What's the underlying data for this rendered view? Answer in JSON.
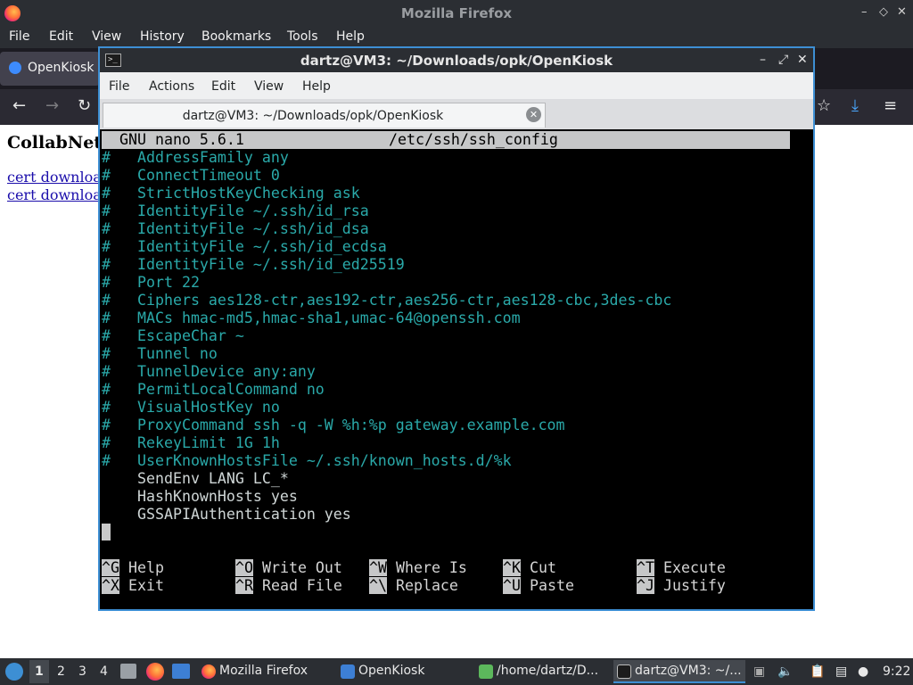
{
  "firefox": {
    "title": "Mozilla Firefox",
    "menu": [
      "File",
      "Edit",
      "View",
      "History",
      "Bookmarks",
      "Tools",
      "Help"
    ],
    "tab_label": "OpenKiosk -",
    "page": {
      "heading": "CollabNet",
      "links": [
        "cert downloa",
        "cert downloa"
      ]
    },
    "icons": {
      "back": "←",
      "forward": "→",
      "reload": "↻",
      "bookmark": "☆",
      "download": "⤓",
      "menu": "≡"
    },
    "window_controls": {
      "minimize": "–",
      "maximize": "◇",
      "close": "✕"
    }
  },
  "terminal": {
    "title": "dartz@VM3: ~/Downloads/opk/OpenKiosk",
    "menu": [
      "File",
      "Actions",
      "Edit",
      "View",
      "Help"
    ],
    "tab_label": "dartz@VM3: ~/Downloads/opk/OpenKiosk",
    "window_controls": {
      "minimize": "–",
      "maximize": "⤢",
      "close": "✕"
    },
    "nano": {
      "version": "GNU nano 5.6.1",
      "filename": "/etc/ssh/ssh_config",
      "lines": [
        {
          "hash": "#",
          "text": "AddressFamily any"
        },
        {
          "hash": "#",
          "text": "ConnectTimeout 0"
        },
        {
          "hash": "#",
          "text": "StrictHostKeyChecking ask"
        },
        {
          "hash": "#",
          "text": "IdentityFile ~/.ssh/id_rsa"
        },
        {
          "hash": "#",
          "text": "IdentityFile ~/.ssh/id_dsa"
        },
        {
          "hash": "#",
          "text": "IdentityFile ~/.ssh/id_ecdsa"
        },
        {
          "hash": "#",
          "text": "IdentityFile ~/.ssh/id_ed25519"
        },
        {
          "hash": "#",
          "text": "Port 22"
        },
        {
          "hash": "#",
          "text": "Ciphers aes128-ctr,aes192-ctr,aes256-ctr,aes128-cbc,3des-cbc"
        },
        {
          "hash": "#",
          "text": "MACs hmac-md5,hmac-sha1,umac-64@openssh.com"
        },
        {
          "hash": "#",
          "text": "EscapeChar ~"
        },
        {
          "hash": "#",
          "text": "Tunnel no"
        },
        {
          "hash": "#",
          "text": "TunnelDevice any:any"
        },
        {
          "hash": "#",
          "text": "PermitLocalCommand no"
        },
        {
          "hash": "#",
          "text": "VisualHostKey no"
        },
        {
          "hash": "#",
          "text": "ProxyCommand ssh -q -W %h:%p gateway.example.com"
        },
        {
          "hash": "#",
          "text": "RekeyLimit 1G 1h"
        },
        {
          "hash": "#",
          "text": "UserKnownHostsFile ~/.ssh/known_hosts.d/%k"
        },
        {
          "hash": "",
          "text": "SendEnv LANG LC_*"
        },
        {
          "hash": "",
          "text": "HashKnownHosts yes"
        },
        {
          "hash": "",
          "text": "GSSAPIAuthentication yes"
        }
      ],
      "shortcuts_row1": [
        {
          "key": "^G",
          "label": "Help"
        },
        {
          "key": "^O",
          "label": "Write Out"
        },
        {
          "key": "^W",
          "label": "Where Is"
        },
        {
          "key": "^K",
          "label": "Cut"
        },
        {
          "key": "^T",
          "label": "Execute"
        }
      ],
      "shortcuts_row2": [
        {
          "key": "^X",
          "label": "Exit"
        },
        {
          "key": "^R",
          "label": "Read File"
        },
        {
          "key": "^\\",
          "label": "Replace"
        },
        {
          "key": "^U",
          "label": "Paste"
        },
        {
          "key": "^J",
          "label": "Justify"
        }
      ]
    }
  },
  "taskbar": {
    "workspaces": [
      "1",
      "2",
      "3",
      "4"
    ],
    "tasks": [
      {
        "label": "Mozilla Firefox"
      },
      {
        "label": "OpenKiosk"
      },
      {
        "label": "/home/dartz/D..."
      },
      {
        "label": "dartz@VM3: ~/..."
      }
    ],
    "clock": "9:22"
  }
}
